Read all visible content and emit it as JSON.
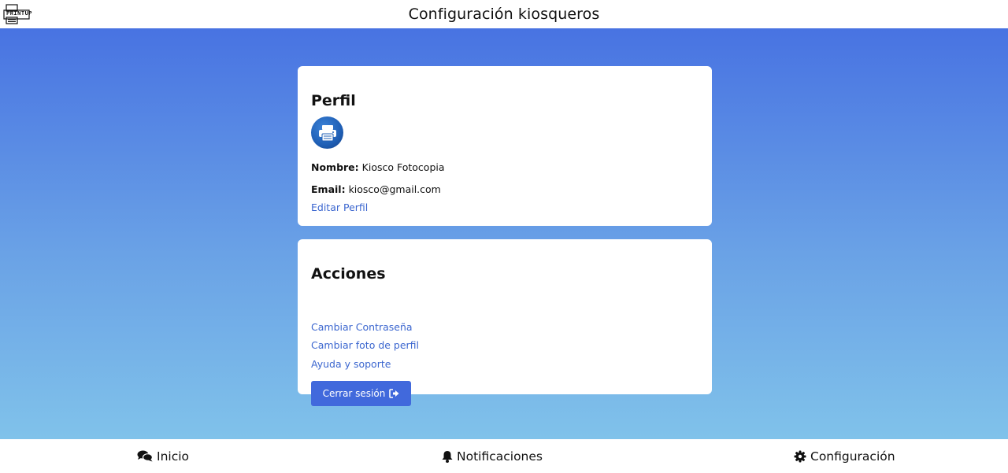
{
  "header": {
    "logo_text": "PRINTUP",
    "title": "Configuración kiosqueros"
  },
  "profile": {
    "title": "Perfil",
    "avatar_icon": "printer-icon",
    "name_label": "Nombre:",
    "name_value": "Kiosco Fotocopia",
    "email_label": "Email:",
    "email_value": "kiosco@gmail.com",
    "edit_link": "Editar Perfil"
  },
  "actions": {
    "title": "Acciones",
    "links": [
      "Cambiar Contraseña",
      "Cambiar foto de perfil",
      "Ayuda y soporte"
    ],
    "logout_label": "Cerrar sesión",
    "logout_icon": "sign-out-icon"
  },
  "bottom_nav": {
    "items": [
      {
        "label": "Inicio",
        "icon": "comments-icon"
      },
      {
        "label": "Notificaciones",
        "icon": "bell-icon"
      },
      {
        "label": "Configuración",
        "icon": "gear-icon"
      }
    ]
  },
  "colors": {
    "accent": "#4169dc",
    "link": "#3b66cf",
    "gradient_top": "#4873e2",
    "gradient_bottom": "#80c2ea"
  }
}
